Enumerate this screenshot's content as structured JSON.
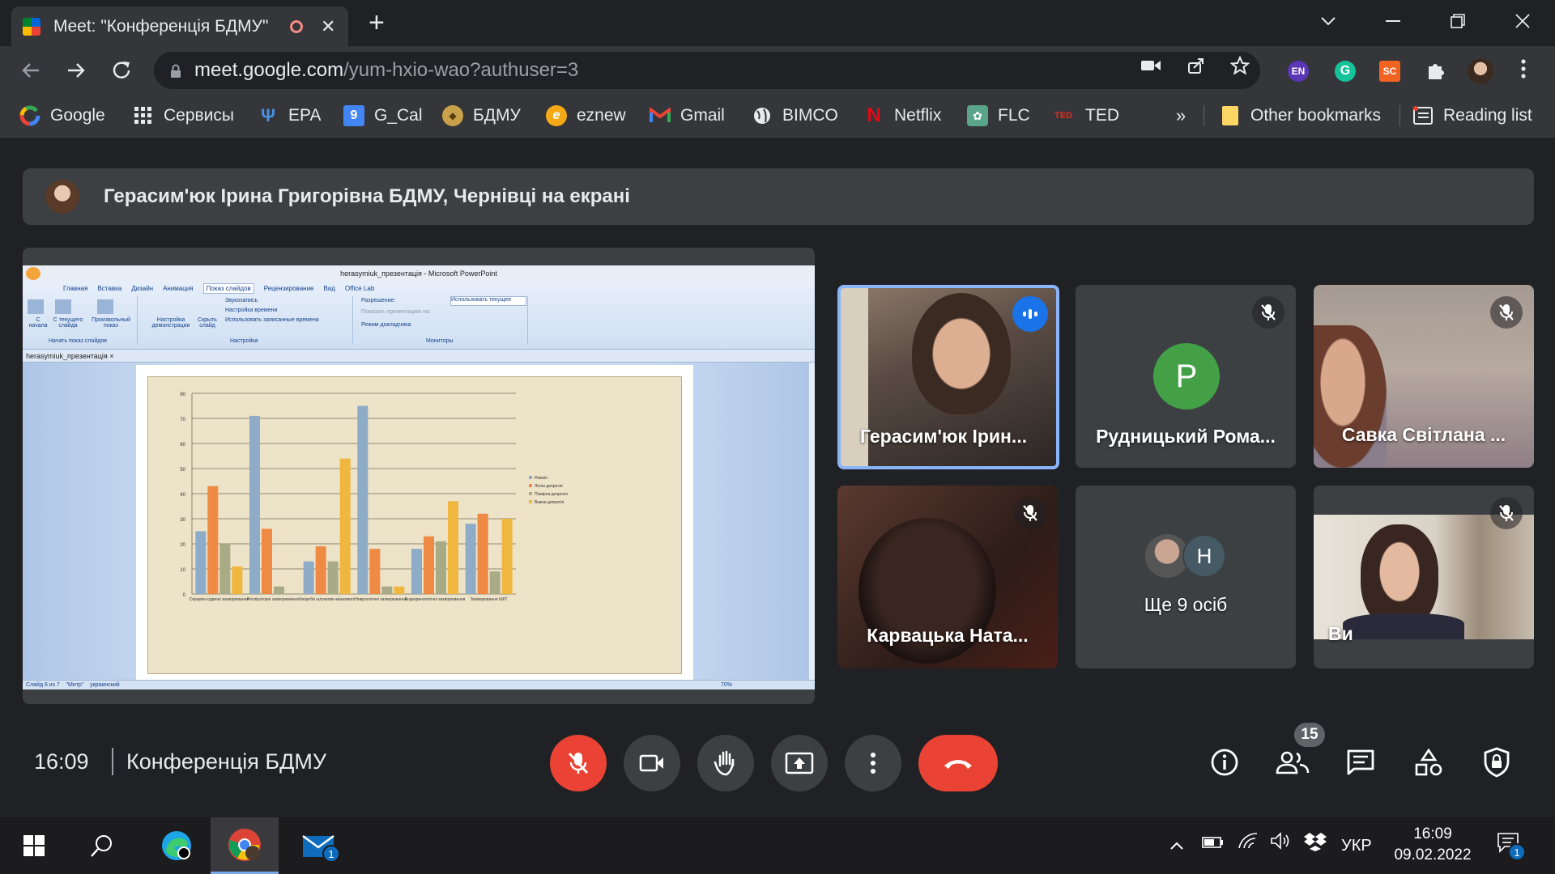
{
  "browser": {
    "tab_title": "Meet: \"Конференція БДМУ\"",
    "url_host": "meet.google.com",
    "url_path": "/yum-hxio-wao?authuser=3",
    "extensions": [
      "EN",
      "G",
      "SC"
    ]
  },
  "bookmarks": [
    {
      "label": "Google",
      "icon": "google-icon"
    },
    {
      "label": "Сервисы",
      "icon": "apps-grid-icon"
    },
    {
      "label": "EPA",
      "icon": "epa-icon"
    },
    {
      "label": "G_Cal",
      "icon": "calendar-icon"
    },
    {
      "label": "БДМУ",
      "icon": "bdmu-icon"
    },
    {
      "label": "eznew",
      "icon": "eznew-icon"
    },
    {
      "label": "Gmail",
      "icon": "gmail-icon"
    },
    {
      "label": "BIMCO",
      "icon": "globe-icon"
    },
    {
      "label": "Netflix",
      "icon": "netflix-icon"
    },
    {
      "label": "FLC",
      "icon": "flc-icon"
    },
    {
      "label": "TED",
      "icon": "ted-icon"
    }
  ],
  "bookmarks_more": "»",
  "other_bookmarks": "Other bookmarks",
  "reading_list": "Reading list",
  "presenting_banner": "Герасим'юк Ірина Григорівна БДМУ, Чернівці на екрані",
  "shared_window": {
    "title": "herasymiuk_презентація - Microsoft PowerPoint",
    "ribbon_tabs": [
      "Главная",
      "Вставка",
      "Дизайн",
      "Анимация",
      "Показ слайдов",
      "Рецензирование",
      "Вид",
      "Office Lab"
    ],
    "ribbon_groups": [
      "Начать показ слайдов",
      "Настройка",
      "Мониторы"
    ],
    "ribbon_items": [
      "С начала",
      "С текущего слайда",
      "Произвольный показ",
      "Настройка демонстрации",
      "Скрыть слайд",
      "Звукозапись",
      "Настройка времени",
      "Использовать записанные времена",
      "Разрешение:",
      "Использовать текущее",
      "Показать презентацию на:",
      "Режим докладчика"
    ],
    "doc_tab": "herasymiuk_презентація",
    "status_left": "Слайд 6 из 7",
    "status_theme": "\"Митр\"",
    "status_lang": "украинский",
    "zoom": "70%"
  },
  "chart_data": {
    "type": "bar",
    "categories": [
      "Серцево-судинні захворювання",
      "Респіраторні захворювання",
      "Хвороби шлунково-кишкового",
      "Неврологічні захворювання",
      "Ендокринологічні захворювання",
      "Захворювання ШКТ"
    ],
    "series": [
      {
        "name": "Ревізія",
        "color": "#8eacc8",
        "values": [
          25,
          71,
          13,
          75,
          18,
          28
        ]
      },
      {
        "name": "Легка депресія",
        "color": "#ef8a45",
        "values": [
          43,
          26,
          19,
          18,
          23,
          32
        ]
      },
      {
        "name": "Помірна депресія",
        "color": "#a9aa86",
        "values": [
          20,
          3,
          13,
          3,
          21,
          9
        ]
      },
      {
        "name": "Важка депресія",
        "color": "#f0b740",
        "values": [
          11,
          0,
          54,
          3,
          37,
          30
        ]
      }
    ],
    "ylim": [
      0,
      80
    ],
    "yticks": [
      0,
      10,
      20,
      30,
      40,
      50,
      60,
      70,
      80
    ],
    "grid": true,
    "legend": "right"
  },
  "participants": [
    {
      "name": "Герасим'юк Ірин...",
      "active": true
    },
    {
      "name": "Рудницький Рома...",
      "avatar_letter": "P",
      "avatar_color": "#43a047"
    },
    {
      "name": "Савка Світлана ..."
    },
    {
      "name": "Карвацька Ната..."
    },
    {
      "name": "Ще 9 осіб",
      "avatar_letter": "Н"
    },
    {
      "name": "Ви"
    }
  ],
  "meeting": {
    "time": "16:09",
    "name": "Конференція БДМУ",
    "people_count": "15"
  },
  "taskbar": {
    "mail_badge": "1",
    "lang": "УКР",
    "time": "16:09",
    "date": "09.02.2022",
    "notif_badge": "1"
  },
  "colors": {
    "meet_red": "#ea4335",
    "meet_bg": "#202124",
    "tile_bg": "#3c4043",
    "active_border": "#8ab4f8"
  }
}
